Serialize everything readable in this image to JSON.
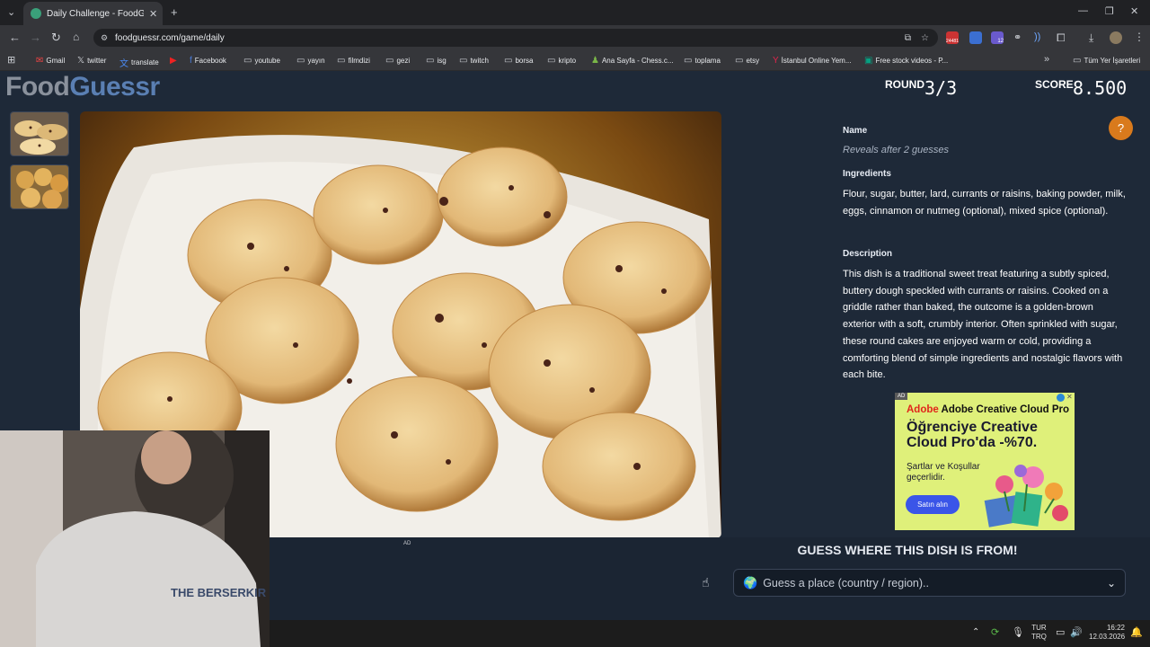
{
  "browser": {
    "tab_title": "Daily Challenge - FoodGuessr |",
    "url": "foodguessr.com/game/daily",
    "bookmarks": [
      "Gmail",
      "twitter",
      "translate",
      "",
      "Facebook",
      "youtube",
      "yayın",
      "filmdizi",
      "gezi",
      "isg",
      "twitch",
      "borsa",
      "kripto",
      "Ana Sayfa - Chess.c...",
      "toplama",
      "etsy",
      "İstanbul Online Yem...",
      "Free stock videos - P..."
    ],
    "all_bookmarks": "Tüm Yer İşaretleri",
    "badge_count": "24481",
    "badge_count2": "12"
  },
  "app": {
    "logo_part1": "Food",
    "logo_part2": "Guessr",
    "round_label": "ROUND",
    "round_value": "3/3",
    "score_label": "SCORE",
    "score_value": "8.500"
  },
  "info": {
    "name_heading": "Name",
    "name_placeholder": "Reveals after 2 guesses",
    "ingredients_heading": "Ingredients",
    "ingredients_text": "Flour, sugar, butter, lard, currants or raisins, baking powder, milk, eggs, cinnamon or nutmeg (optional), mixed spice (optional).",
    "description_heading": "Description",
    "description_text": "This dish is a traditional sweet treat featuring a subtly spiced, buttery dough speckled with currants or raisins. Cooked on a griddle rather than baked, the outcome is a golden-brown exterior with a soft, crumbly interior. Often sprinkled with sugar, these round cakes are enjoyed warm or cold, providing a comforting blend of simple ingredients and nostalgic flavors with each bite."
  },
  "ad": {
    "badge": "AD",
    "brand": "Adobe Creative Cloud Pro",
    "headline": "Öğrenciye Creative Cloud Pro'da -%70.",
    "terms": "Şartlar ve Koşullar geçerlidir.",
    "cta": "Satın alın",
    "small_tag": "AD"
  },
  "guess": {
    "title": "GUESS WHERE THIS DISH IS FROM!",
    "placeholder": "Guess a place (country / region).."
  },
  "taskbar": {
    "lang_top": "TUR",
    "lang_bottom": "TRQ",
    "time": "16:22",
    "date": "12.03.2026"
  },
  "webcam": {
    "shirt_text": "THE BERSERKIR"
  },
  "colors": {
    "page_bg": "#1e2938",
    "accent_orange": "#d97a1c",
    "logo_blue": "#5a7fb3"
  }
}
